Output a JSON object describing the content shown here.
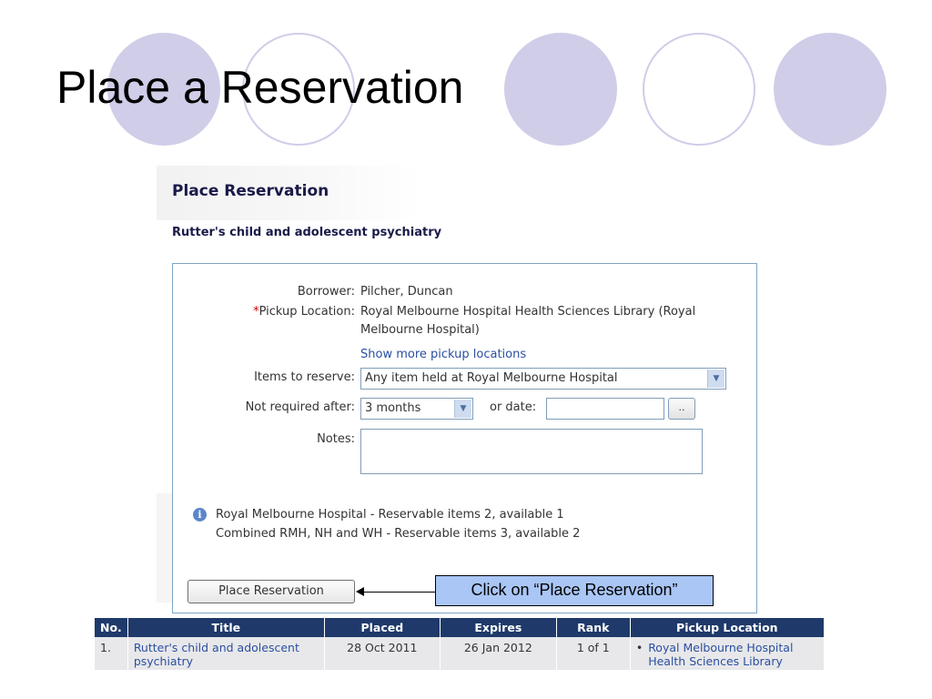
{
  "slide": {
    "title": "Place a Reservation"
  },
  "screen": {
    "heading": "Place Reservation",
    "book_title": "Rutter's child and adolescent psychiatry",
    "borrower_label": "Borrower:",
    "borrower_value": "Pilcher, Duncan",
    "pickup_required_mark": "*",
    "pickup_label": "Pickup Location:",
    "pickup_value_line1": "Royal Melbourne Hospital Health Sciences Library (Royal",
    "pickup_value_line2": "Melbourne Hospital)",
    "show_more_link": "Show more pickup locations",
    "items_label": "Items to reserve:",
    "items_value": "Any item held at Royal Melbourne Hospital",
    "not_required_label": "Not required after:",
    "not_required_value": "3 months",
    "or_date_label": "or date:",
    "date_value": "",
    "date_picker_label": "..",
    "notes_label": "Notes:",
    "notes_value": "",
    "info_line1": "Royal Melbourne Hospital - Reservable items 2, available 1",
    "info_line2": "Combined RMH, NH and WH - Reservable items 3, available 2",
    "place_button": "Place Reservation"
  },
  "callout": {
    "text": "Click on “Place Reservation”"
  },
  "table": {
    "headers": [
      "No.",
      "Title",
      "Placed",
      "Expires",
      "Rank",
      "Pickup Location"
    ],
    "rows": [
      {
        "no": "1.",
        "title": "Rutter's child and adolescent psychiatry",
        "placed": "28 Oct 2011",
        "expires": "26 Jan 2012",
        "rank": "1 of 1",
        "pickup_bullet": "•",
        "pickup": "Royal Melbourne Hospital Health Sciences Library"
      }
    ]
  },
  "colors": {
    "circle": "#cfcde8",
    "table_header": "#1f3a6a",
    "link": "#2a4fa0",
    "callout_bg": "#aac6f5"
  }
}
